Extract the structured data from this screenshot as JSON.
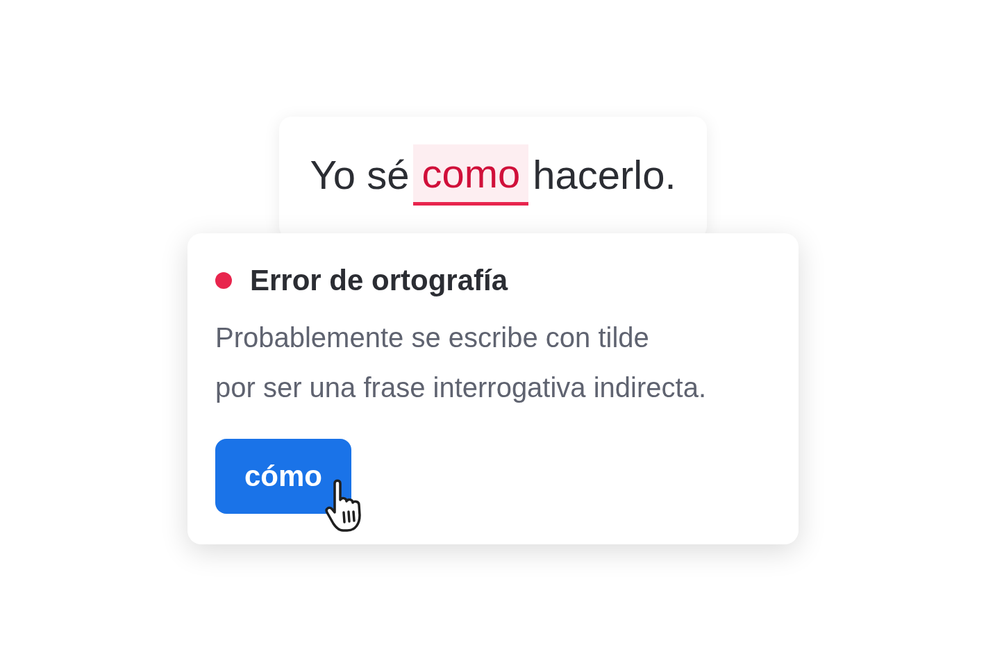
{
  "sentence": {
    "before": "Yo sé",
    "error_word": "como",
    "after": "hacerlo."
  },
  "popup": {
    "color": "#e8254d",
    "title": "Error de ortografía",
    "description": [
      "Probablemente se escribe con tilde",
      "por ser una frase interrogativa indirecta."
    ],
    "suggestion": "cómo"
  }
}
